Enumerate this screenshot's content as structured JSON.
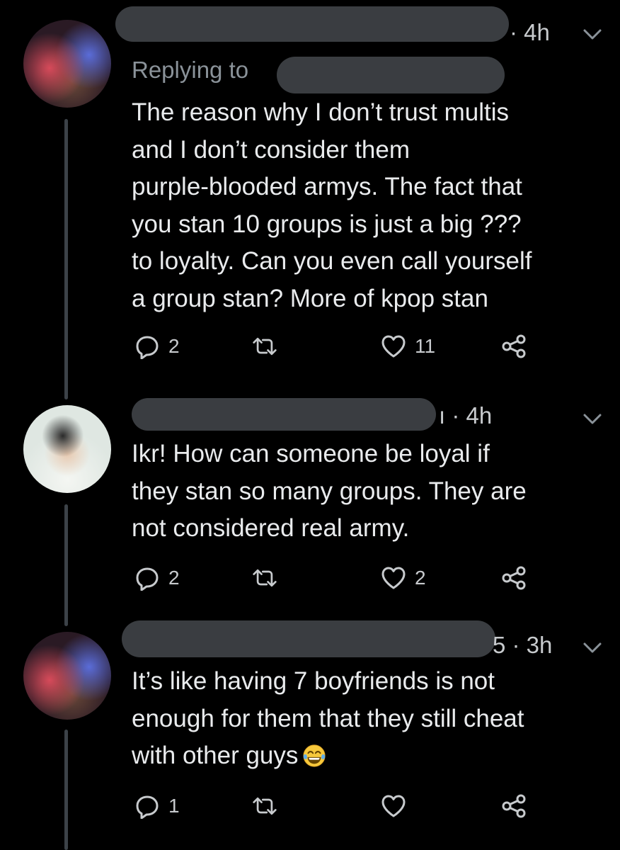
{
  "tweets": [
    {
      "meta": "· 4h",
      "replying_label": "Replying to",
      "lines": [
        "The reason why I don’t trust multis",
        "and I don’t consider them",
        "purple-blooded armys.  The fact that",
        "you stan 10 groups is just a big ???",
        "to loyalty. Can you even call yourself",
        "a group stan? More of kpop stan"
      ],
      "reply_count": "2",
      "retweet_count": "",
      "like_count": "11"
    },
    {
      "meta": "ı · 4h",
      "lines": [
        "Ikr! How can someone be loyal if",
        "they stan so many groups. They are",
        "not considered real army."
      ],
      "reply_count": "2",
      "retweet_count": "",
      "like_count": "2"
    },
    {
      "meta": "5 · 3h",
      "lines": [
        "It’s like having 7 boyfriends is not",
        "enough for them that they still cheat",
        "with other guys"
      ],
      "reply_count": "1",
      "retweet_count": "",
      "like_count": ""
    }
  ],
  "icons": {
    "reply": "reply-icon",
    "retweet": "retweet-icon",
    "like": "heart-icon",
    "share": "share-icon",
    "menu": "chevron-down-icon",
    "emoji": "face-with-tears-of-joy-emoji"
  },
  "colors": {
    "background": "#000000",
    "text": "#e9ebed",
    "secondary_text": "#8a9299",
    "thread_line": "#3c4248",
    "redaction": "#3a3d41"
  }
}
